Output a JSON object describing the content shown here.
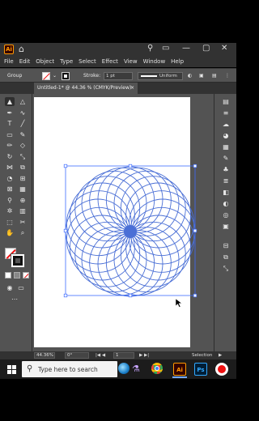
{
  "app": {
    "logo_text": "Ai",
    "menu": [
      "File",
      "Edit",
      "Object",
      "Type",
      "Select",
      "Effect",
      "View",
      "Window",
      "Help"
    ]
  },
  "control_bar": {
    "selection_label": "Group",
    "stroke_label": "Stroke:",
    "stroke_weight": "1 pt",
    "profile": "Uniform"
  },
  "document": {
    "tab_title": "Untitled-1* @ 44.36 % (CMYK/Preview)",
    "close_glyph": "×"
  },
  "status": {
    "zoom": "44.36%",
    "rotation": "0°",
    "artboard": "1",
    "tool": "Selection"
  },
  "taskbar": {
    "search_placeholder": "Type here to search",
    "apps": [
      "Ai",
      "Ps"
    ]
  },
  "artwork": {
    "type": "spirograph",
    "circle_count": 24,
    "stroke_color": "#4a6fd6",
    "selection_color": "#3d6bff"
  },
  "colors": {
    "chrome_dark": "#323232",
    "panel": "#535353",
    "accent_ai": "#ff9a00"
  }
}
